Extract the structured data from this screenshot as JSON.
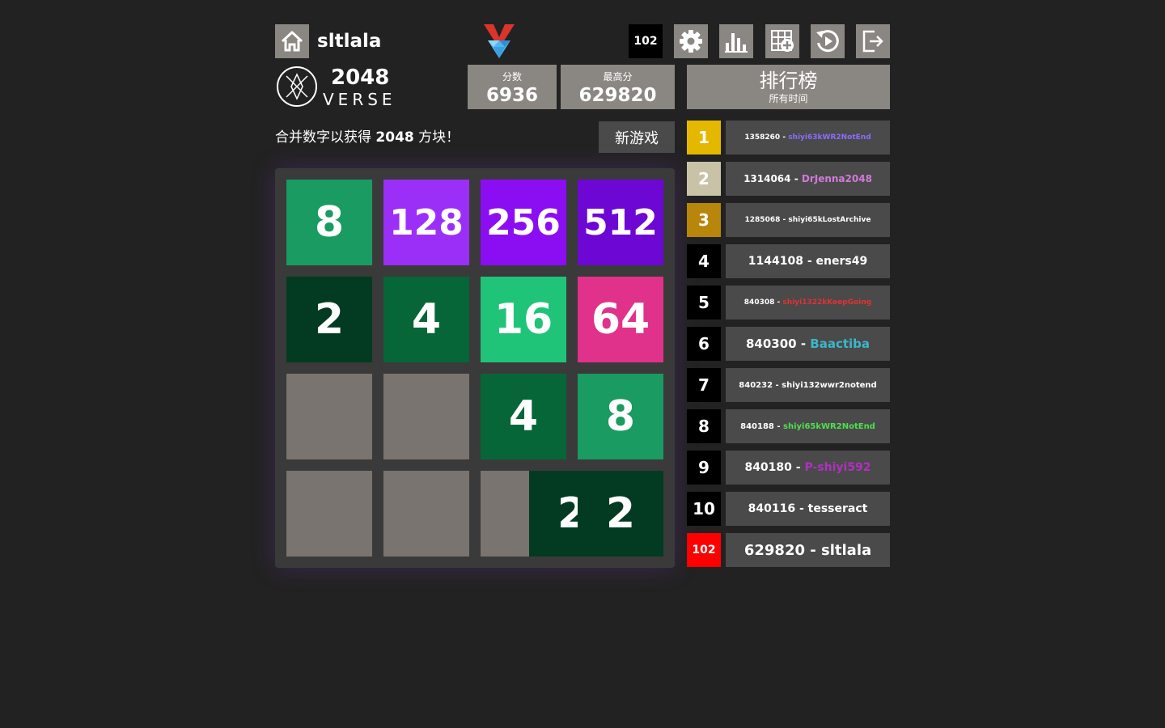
{
  "header": {
    "username": "sltlala",
    "rank_badge": "102",
    "logo_title": "2048",
    "logo_sub": "VERSE"
  },
  "scores": {
    "score_label": "分数",
    "score_value": "6936",
    "best_label": "最高分",
    "best_value": "629820"
  },
  "leaderboard": {
    "title": "排行榜",
    "subtitle": "所有时间",
    "entries": [
      {
        "rank": "1",
        "score": "1358260",
        "name": "shiyi63kWR2NotEnd",
        "rank_color": "#e5b800",
        "name_color": "#8a6cff",
        "size": 9
      },
      {
        "rank": "2",
        "score": "1314064",
        "name": "DrJenna2048",
        "rank_color": "#c9c2a6",
        "name_color": "#d07ad8",
        "size": 12
      },
      {
        "rank": "3",
        "score": "1285068",
        "name": "shiyi65kLostArchive",
        "rank_color": "#b8860b",
        "name_color": "#ffffff",
        "size": 9
      },
      {
        "rank": "4",
        "score": "1144108",
        "name": "eners49",
        "rank_color": "#000000",
        "name_color": "#ffffff",
        "size": 14
      },
      {
        "rank": "5",
        "score": "840308",
        "name": "shiyi1322kKeepGoing",
        "rank_color": "#000000",
        "name_color": "#e53030",
        "size": 9
      },
      {
        "rank": "6",
        "score": "840300",
        "name": "Baactiba",
        "rank_color": "#000000",
        "name_color": "#3ab8c8",
        "size": 15
      },
      {
        "rank": "7",
        "score": "840232",
        "name": "shiyi132wwr2notend",
        "rank_color": "#000000",
        "name_color": "#ffffff",
        "size": 10
      },
      {
        "rank": "8",
        "score": "840188",
        "name": "shiyi65kWR2NotEnd",
        "rank_color": "#000000",
        "name_color": "#4ee04e",
        "size": 10
      },
      {
        "rank": "9",
        "score": "840180",
        "name": "P-shiyi592",
        "rank_color": "#000000",
        "name_color": "#b030c0",
        "size": 14
      },
      {
        "rank": "10",
        "score": "840116",
        "name": "tesseract",
        "rank_color": "#000000",
        "name_color": "#ffffff",
        "size": 14
      },
      {
        "rank": "102",
        "score": "629820",
        "name": "sltlala",
        "rank_color": "#ff0000",
        "name_color": "#ffffff",
        "size": 18
      }
    ]
  },
  "intro": {
    "text_before": "合并数字以获得 ",
    "highlight": "2048",
    "text_after": " 方块！"
  },
  "new_game_label": "新游戏",
  "colors": {
    "background": "#222222",
    "button": "#8a8682",
    "board": "#3a3a3a",
    "empty_cell": "#79746f"
  },
  "board": {
    "tiles": [
      {
        "value": "8",
        "row": 0,
        "col": 0,
        "color": "#1a9b61"
      },
      {
        "value": "128",
        "row": 0,
        "col": 1,
        "color": "#9b2ff7"
      },
      {
        "value": "256",
        "row": 0,
        "col": 2,
        "color": "#8b0ef3"
      },
      {
        "value": "512",
        "row": 0,
        "col": 3,
        "color": "#6d07d3"
      },
      {
        "value": "2",
        "row": 1,
        "col": 0,
        "color": "#033b22"
      },
      {
        "value": "4",
        "row": 1,
        "col": 1,
        "color": "#066638"
      },
      {
        "value": "16",
        "row": 1,
        "col": 2,
        "color": "#1fc479"
      },
      {
        "value": "64",
        "row": 1,
        "col": 3,
        "color": "#e0328a"
      },
      {
        "value": "4",
        "row": 2,
        "col": 2,
        "color": "#066638"
      },
      {
        "value": "8",
        "row": 2,
        "col": 3,
        "color": "#1a9b61"
      },
      {
        "value": "2",
        "row": 3,
        "col": 2.5,
        "color": "#033b22"
      },
      {
        "value": "2",
        "row": 3,
        "col": 3,
        "color": "#033b22"
      }
    ]
  },
  "icons": [
    "home-icon",
    "logo-diamond-icon",
    "gear-icon",
    "stats-icon",
    "add-board-icon",
    "replay-icon",
    "logout-icon"
  ]
}
